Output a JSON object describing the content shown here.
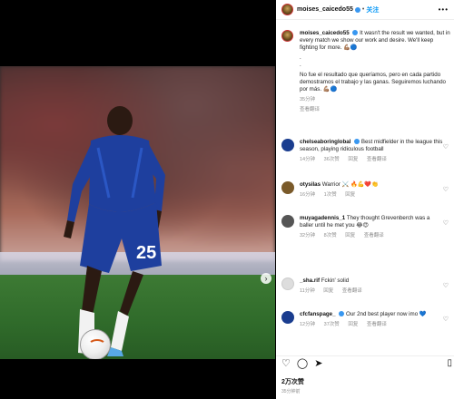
{
  "header": {
    "username": "moises_caicedo55",
    "separator": "•",
    "follow_label": "关注",
    "more": "•••"
  },
  "post": {
    "username": "moises_caicedo55",
    "caption_en": "It wasn't the result we wanted, but in every match we show our work and desire. We'll keep fighting for more.",
    "caption_es": "No fue el resultado que queríamos, pero en cada partido demostramos el trabajo y las ganas. Seguiremos luchando por más.",
    "time": "35分钟",
    "translate": "查看翻译"
  },
  "comments": [
    {
      "username": "chelseaboringlobal",
      "text": "Best midfielder in the league this season, playing ridiculous football",
      "time": "14分钟",
      "likes": "36次赞",
      "reply": "回复",
      "translate": "查看翻译",
      "avatar_color": "#1a3d8f"
    },
    {
      "username": "otysilas",
      "text": "Warrior ⚔️ 🔥💪❤️👏",
      "time": "16分钟",
      "likes": "1次赞",
      "reply": "回复",
      "translate": "",
      "avatar_color": "#7a5a2a"
    },
    {
      "username": "muyagadennis_1",
      "text": "They thought Grevenberch was a baller until he met you 😂😍",
      "time": "32分钟",
      "likes": "8次赞",
      "reply": "回复",
      "translate": "查看翻译",
      "avatar_color": "#555555"
    },
    {
      "username": "_sha.rif",
      "text": "Fckin' solid",
      "time": "11分钟",
      "likes": "",
      "reply": "回复",
      "translate": "查看翻译",
      "avatar_color": "#d8d8d8"
    },
    {
      "username": "cfcfanspage_",
      "text": "Our 2nd best player now imo 💙",
      "time": "12分钟",
      "likes": "37次赞",
      "reply": "回复",
      "translate": "查看翻译",
      "avatar_color": "#1a3d8f"
    }
  ],
  "footer": {
    "likes": "2万次赞",
    "ago": "35分钟前"
  },
  "media": {
    "jersey_number": "25",
    "next_arrow": "›"
  }
}
